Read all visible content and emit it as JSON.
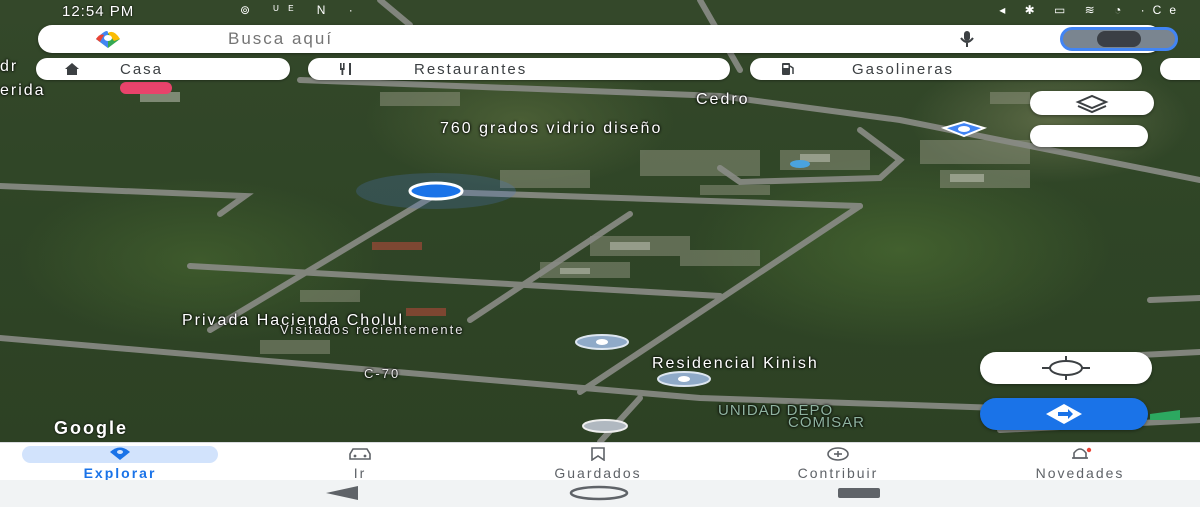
{
  "status_bar": {
    "time": "12:54 PM",
    "left_icons": "⊚ ᵁᴱ N ·",
    "right_icons": "◂ ✱ ▭ ≋ ◔ ·Ce"
  },
  "search": {
    "placeholder": "Busca aquí"
  },
  "chips": [
    {
      "label": "Casa",
      "icon": "home-icon"
    },
    {
      "label": "Restaurantes",
      "icon": "fork-knife-icon"
    },
    {
      "label": "Gasolineras",
      "icon": "gas-station-icon"
    }
  ],
  "map": {
    "labels": {
      "merida": "erida",
      "cedro": "Cedro",
      "vidrio": "760 grados vidrio diseño",
      "privada": "Privada Hacienda Cholul",
      "visited": "Visitados recientemente",
      "residencial": "Residencial Kinish",
      "unidad_1": "UNIDAD DEPO",
      "unidad_2": "COMISAR",
      "road_c70": "C-70",
      "top_left": "dr"
    },
    "attribution": "Google"
  },
  "bottom_nav": {
    "items": [
      {
        "label": "Explorar",
        "icon": "explore-pin-icon",
        "active": true
      },
      {
        "label": "Ir",
        "icon": "car-icon",
        "active": false
      },
      {
        "label": "Guardados",
        "icon": "bookmark-icon",
        "active": false
      },
      {
        "label": "Contribuir",
        "icon": "add-circle-icon",
        "active": false
      },
      {
        "label": "Novedades",
        "icon": "bell-icon",
        "active": false
      }
    ]
  },
  "colors": {
    "accent": "#1a73e8",
    "active_pill": "#d2e3fc"
  }
}
